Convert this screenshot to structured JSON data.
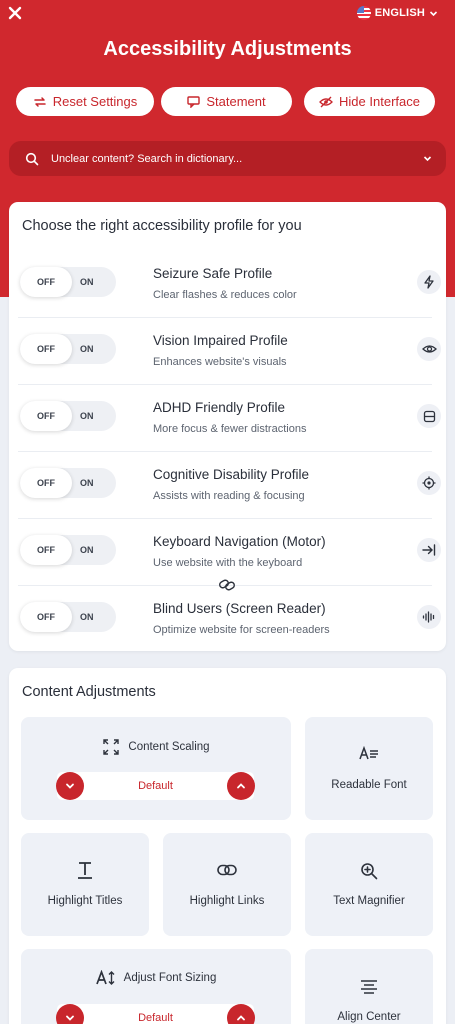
{
  "header": {
    "language": "ENGLISH",
    "title": "Accessibility Adjustments",
    "buttons": {
      "reset": "Reset Settings",
      "statement": "Statement",
      "hide": "Hide Interface"
    },
    "search_placeholder": "Unclear content? Search in dictionary..."
  },
  "profiles_card": {
    "title": "Choose the right accessibility profile for you",
    "toggle_off": "OFF",
    "toggle_on": "ON",
    "profiles": [
      {
        "name": "Seizure Safe Profile",
        "desc": "Clear flashes & reduces color",
        "icon": "lightning-icon",
        "enabled": false
      },
      {
        "name": "Vision Impaired Profile",
        "desc": "Enhances website's visuals",
        "icon": "eye-icon",
        "enabled": false
      },
      {
        "name": "ADHD Friendly Profile",
        "desc": "More focus & fewer distractions",
        "icon": "focus-box-icon",
        "enabled": false
      },
      {
        "name": "Cognitive Disability Profile",
        "desc": "Assists with reading & focusing",
        "icon": "target-icon",
        "enabled": false
      },
      {
        "name": "Keyboard Navigation (Motor)",
        "desc": "Use website with the keyboard",
        "icon": "arrow-to-line-icon",
        "enabled": false
      },
      {
        "name": "Blind Users (Screen Reader)",
        "desc": "Optimize website for screen-readers",
        "icon": "audio-wave-icon",
        "enabled": false
      }
    ]
  },
  "content_card": {
    "title": "Content Adjustments",
    "content_scaling": {
      "label": "Content Scaling",
      "value": "Default"
    },
    "readable_font": "Readable Font",
    "highlight_titles": "Highlight Titles",
    "highlight_links": "Highlight Links",
    "text_magnifier": "Text Magnifier",
    "adjust_font_sizing": {
      "label": "Adjust Font Sizing",
      "value": "Default"
    },
    "align_center": "Align Center"
  },
  "colors": {
    "brand_red": "#d0282e",
    "dark_red": "#b41f25",
    "page_bg": "#eceff5",
    "tile_bg": "#eef1f7"
  }
}
